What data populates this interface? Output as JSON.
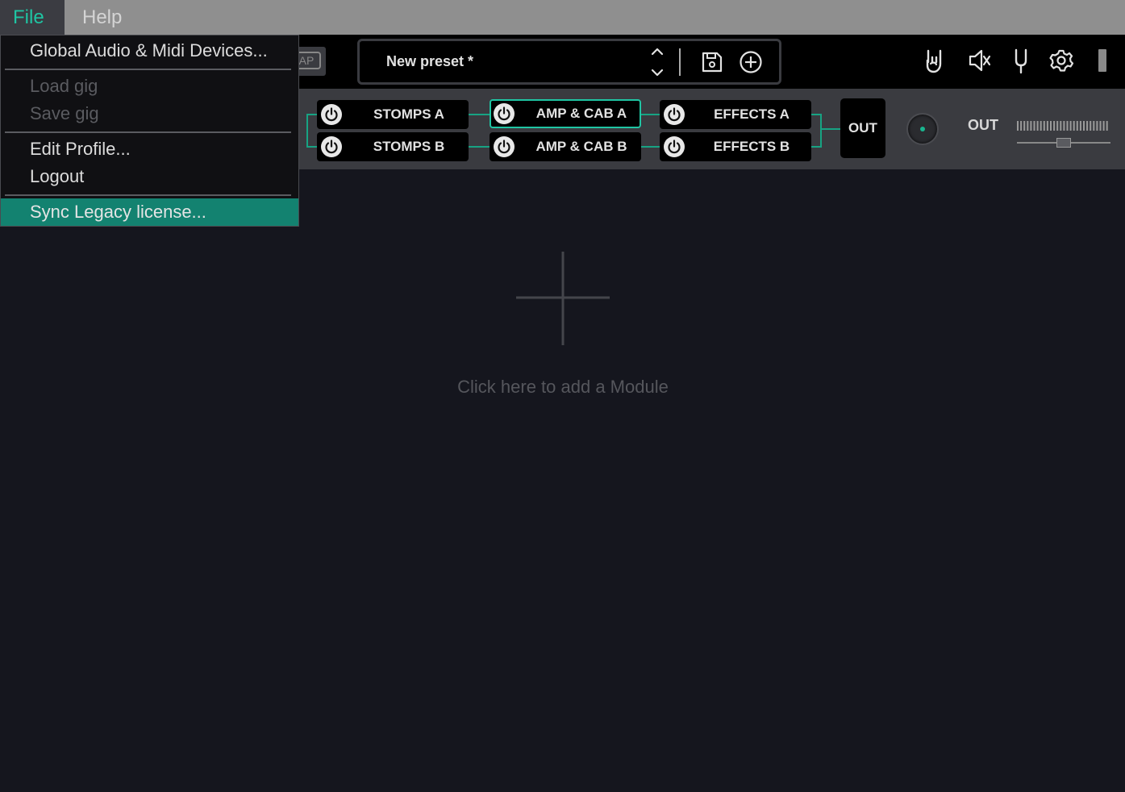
{
  "menubar": {
    "file_label": "File",
    "help_label": "Help"
  },
  "file_menu": {
    "items": [
      {
        "label": "Global Audio & Midi Devices...",
        "enabled": true
      },
      {
        "label": "Load gig",
        "enabled": false
      },
      {
        "label": "Save gig",
        "enabled": false
      },
      {
        "label": "Edit Profile...",
        "enabled": true
      },
      {
        "label": "Logout",
        "enabled": true
      },
      {
        "label": "Sync Legacy license...",
        "enabled": true,
        "highlighted": true
      }
    ]
  },
  "header": {
    "tap_label": "AP",
    "preset_name": "New preset *",
    "icons": [
      "chevron-up-down-icon",
      "save-icon",
      "add-circle-icon",
      "rock-hand-icon",
      "speaker-mute-icon",
      "tuning-fork-icon",
      "gear-icon"
    ]
  },
  "chain": {
    "row_a": [
      {
        "label": "STOMPS A",
        "selected": false
      },
      {
        "label": "AMP & CAB A",
        "selected": true
      },
      {
        "label": "EFFECTS A",
        "selected": false
      }
    ],
    "row_b": [
      {
        "label": "STOMPS B",
        "selected": false
      },
      {
        "label": "AMP & CAB B",
        "selected": false
      },
      {
        "label": "EFFECTS B",
        "selected": false
      }
    ],
    "out_box_label": "OUT",
    "out_label": "OUT"
  },
  "main": {
    "add_module_text": "Click here to add a Module"
  },
  "colors": {
    "accent": "#1fc5a3",
    "highlight": "#138270",
    "background": "#15161e",
    "chain_background": "#3a3b40"
  }
}
